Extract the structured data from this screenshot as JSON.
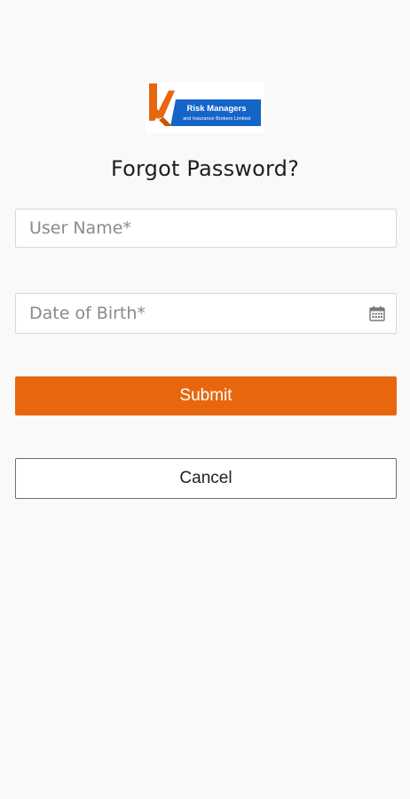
{
  "logo": {
    "line1": "Risk Managers",
    "line2": "and Insurance Brokers Limited",
    "colors": {
      "orange": "#e8670e",
      "blue": "#1565c9"
    }
  },
  "page": {
    "title": "Forgot Password?"
  },
  "form": {
    "username_placeholder": "User Name*",
    "dob_placeholder": "Date of Birth*",
    "dob_icon": "calendar-icon",
    "submit_label": "Submit",
    "cancel_label": "Cancel"
  },
  "colors": {
    "accent": "#e8670e",
    "background": "#f9f9f9"
  }
}
